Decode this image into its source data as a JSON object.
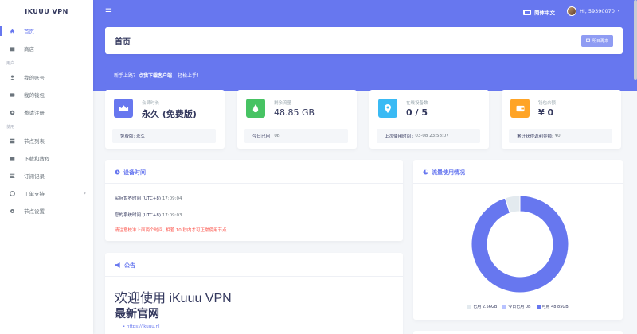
{
  "brand": "IKUUU VPN",
  "sidebar": {
    "items": [
      {
        "label": "首页",
        "icon": "home-icon"
      },
      {
        "label": "商店",
        "icon": "store-icon"
      }
    ],
    "section_user": "用户",
    "user_items": [
      {
        "label": "我的账号",
        "icon": "user-icon"
      },
      {
        "label": "我的钱包",
        "icon": "wallet-icon"
      },
      {
        "label": "邀请注册",
        "icon": "invite-icon"
      }
    ],
    "section_use": "使用",
    "use_items": [
      {
        "label": "节点列表",
        "icon": "list-icon"
      },
      {
        "label": "下载和教程",
        "icon": "download-icon"
      },
      {
        "label": "订阅记录",
        "icon": "record-icon"
      },
      {
        "label": "工单支持",
        "icon": "ticket-icon"
      },
      {
        "label": "节点设置",
        "icon": "settings-icon"
      }
    ]
  },
  "topbar": {
    "lang": "简体中文",
    "user": "Hi, 59390070"
  },
  "page": {
    "title": "首页",
    "checkin_button": "明日再来"
  },
  "notice": {
    "prefix": "新手上路？",
    "bold": "点我下载客户端",
    "suffix": "，轻松上手！"
  },
  "stats": [
    {
      "label": "会员时长",
      "value": "永久 (免费版)",
      "sub_label": "免费版:",
      "sub_value": "永久",
      "color": "#6777ef"
    },
    {
      "label": "剩余流量",
      "value": "48.85 GB",
      "sub_label": "今日已用 :",
      "sub_value": "0B",
      "color": "#47c363"
    },
    {
      "label": "在线设备数",
      "value": "0 / 5",
      "sub_label": "上次使用时间 :",
      "sub_value": "03-08 23:58:07",
      "color": "#3abaf4"
    },
    {
      "label": "钱包余额",
      "value": "¥ 0",
      "sub_label": "累计获得返利金额:",
      "sub_value": "¥0",
      "color": "#ffa426"
    }
  ],
  "device": {
    "title": "设备时间",
    "real_label": "实际世界时间 (UTC+8)",
    "real_value": "17:09:04",
    "sys_label": "您的系统时间 (UTC+8)",
    "sys_value": "17:09:03",
    "warning": "请注意校准上面两个时间, 相差 10 秒内才可正常使用节点"
  },
  "announce": {
    "title": "公告",
    "heading1": "欢迎使用 iKuuu VPN",
    "heading2": "最新官网",
    "link": "https://ikuuu.nl"
  },
  "traffic": {
    "title": "流量使用情况"
  },
  "chart_data": {
    "type": "pie",
    "categories": [
      "已用 2.56GB",
      "今日已用 0B",
      "可用 48.85GB"
    ],
    "values": [
      2.56,
      0,
      48.85
    ],
    "colors": [
      "#e3eaef",
      "#b8c2ff",
      "#6777ef"
    ],
    "legend": "bottom"
  }
}
